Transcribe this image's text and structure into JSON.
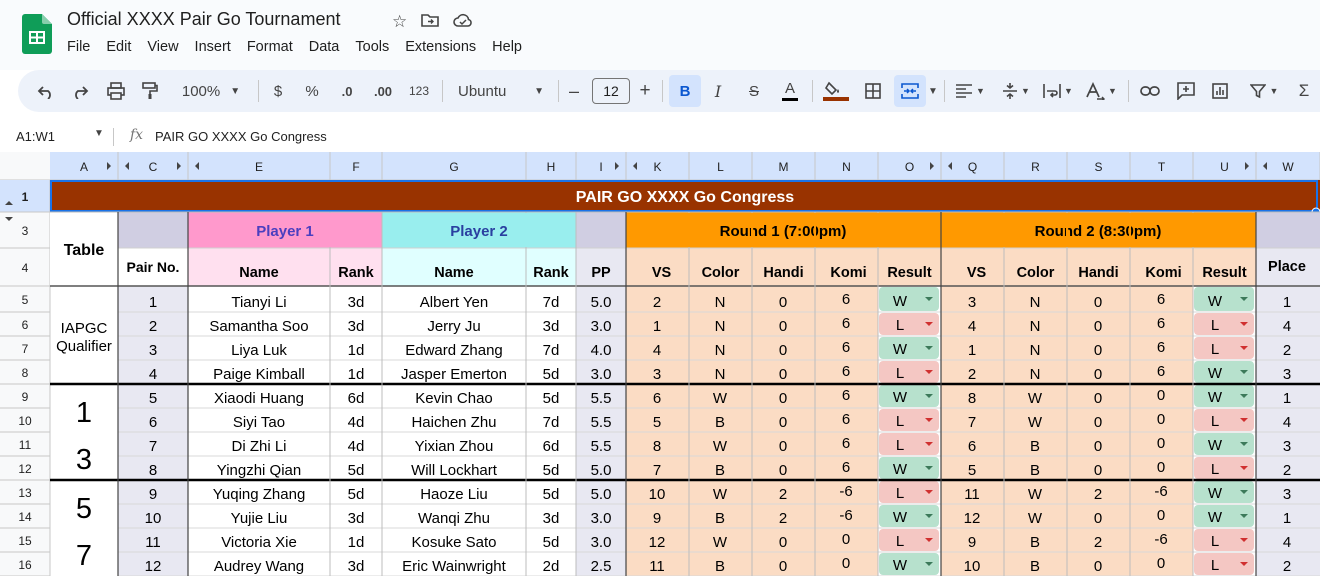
{
  "app": {
    "title": "Official XXXX Pair Go Tournament",
    "menu": [
      "File",
      "Edit",
      "View",
      "Insert",
      "Format",
      "Data",
      "Tools",
      "Extensions",
      "Help"
    ]
  },
  "toolbar": {
    "zoom": "100%",
    "currency": "$",
    "percent": "%",
    "decrease_decimals": ".0",
    "increase_decimals": ".00",
    "number_format": "123",
    "font": "Ubuntu",
    "font_size": "12",
    "bold": "B",
    "italic": "I",
    "strikethrough": "S",
    "text_color": "A"
  },
  "formula_bar": {
    "cell_ref": "A1:W1",
    "fx": "fx",
    "content": "PAIR GO XXXX Go Congress"
  },
  "columns": [
    "A",
    "C",
    "E",
    "F",
    "G",
    "H",
    "I",
    "K",
    "L",
    "M",
    "N",
    "O",
    "Q",
    "R",
    "S",
    "T",
    "U",
    "W"
  ],
  "rows": [
    "1",
    "3",
    "4",
    "5",
    "6",
    "7",
    "8",
    "9",
    "10",
    "11",
    "12",
    "13",
    "14",
    "15",
    "16"
  ],
  "sheet": {
    "banner": "PAIR GO XXXX Go Congress",
    "table_label": "Table",
    "pair_no_label": "Pair No.",
    "player1": "Player 1",
    "player2": "Player 2",
    "round1": "Round 1 (7:00pm)",
    "round2": "Round 2 (8:30pm)",
    "name_label": "Name",
    "rank_label": "Rank",
    "pp_label": "PP",
    "vs_label": "VS",
    "color_label": "Color",
    "handi_label": "Handi",
    "komi_label": "Komi",
    "result_label": "Result",
    "place_label": "Place",
    "table_groups": [
      {
        "label": "IAPGC Qualifier",
        "label_lines": [
          "IAPGC",
          "Qualifier"
        ]
      },
      {
        "label": "1 3",
        "label_lines": [
          "1",
          "3"
        ]
      },
      {
        "label": "5 7",
        "label_lines": [
          "5",
          "7"
        ]
      }
    ]
  },
  "pairs": [
    {
      "pair": "1",
      "p1": "Tianyi Li",
      "r1": "3d",
      "p2": "Albert Yen",
      "r2": "7d",
      "pp": "5.0",
      "vs1": "2",
      "c1": "N",
      "h1": "0",
      "k1": "6",
      "res1": "W",
      "vs2": "3",
      "c2": "N",
      "h2": "0",
      "k2": "6",
      "res2": "W",
      "place": "1"
    },
    {
      "pair": "2",
      "p1": "Samantha Soo",
      "r1": "3d",
      "p2": "Jerry Ju",
      "r2": "3d",
      "pp": "3.0",
      "vs1": "1",
      "c1": "N",
      "h1": "0",
      "k1": "6",
      "res1": "L",
      "vs2": "4",
      "c2": "N",
      "h2": "0",
      "k2": "6",
      "res2": "L",
      "place": "4"
    },
    {
      "pair": "3",
      "p1": "Liya Luk",
      "r1": "1d",
      "p2": "Edward Zhang",
      "r2": "7d",
      "pp": "4.0",
      "vs1": "4",
      "c1": "N",
      "h1": "0",
      "k1": "6",
      "res1": "W",
      "vs2": "1",
      "c2": "N",
      "h2": "0",
      "k2": "6",
      "res2": "L",
      "place": "2"
    },
    {
      "pair": "4",
      "p1": "Paige Kimball",
      "r1": "1d",
      "p2": "Jasper Emerton",
      "r2": "5d",
      "pp": "3.0",
      "vs1": "3",
      "c1": "N",
      "h1": "0",
      "k1": "6",
      "res1": "L",
      "vs2": "2",
      "c2": "N",
      "h2": "0",
      "k2": "6",
      "res2": "W",
      "place": "3"
    },
    {
      "pair": "5",
      "p1": "Xiaodi Huang",
      "r1": "6d",
      "p2": "Kevin Chao",
      "r2": "5d",
      "pp": "5.5",
      "vs1": "6",
      "c1": "W",
      "h1": "0",
      "k1": "6",
      "res1": "W",
      "vs2": "8",
      "c2": "W",
      "h2": "0",
      "k2": "0",
      "res2": "W",
      "place": "1"
    },
    {
      "pair": "6",
      "p1": "Siyi Tao",
      "r1": "4d",
      "p2": "Haichen Zhu",
      "r2": "7d",
      "pp": "5.5",
      "vs1": "5",
      "c1": "B",
      "h1": "0",
      "k1": "6",
      "res1": "L",
      "vs2": "7",
      "c2": "W",
      "h2": "0",
      "k2": "0",
      "res2": "L",
      "place": "4"
    },
    {
      "pair": "7",
      "p1": "Di Zhi Li",
      "r1": "4d",
      "p2": "Yixian Zhou",
      "r2": "6d",
      "pp": "5.5",
      "vs1": "8",
      "c1": "W",
      "h1": "0",
      "k1": "6",
      "res1": "L",
      "vs2": "6",
      "c2": "B",
      "h2": "0",
      "k2": "0",
      "res2": "W",
      "place": "3"
    },
    {
      "pair": "8",
      "p1": "Yingzhi Qian",
      "r1": "5d",
      "p2": "Will Lockhart",
      "r2": "5d",
      "pp": "5.0",
      "vs1": "7",
      "c1": "B",
      "h1": "0",
      "k1": "6",
      "res1": "W",
      "vs2": "5",
      "c2": "B",
      "h2": "0",
      "k2": "0",
      "res2": "L",
      "place": "2"
    },
    {
      "pair": "9",
      "p1": "Yuqing Zhang",
      "r1": "5d",
      "p2": "Haoze Liu",
      "r2": "5d",
      "pp": "5.0",
      "vs1": "10",
      "c1": "W",
      "h1": "2",
      "k1": "-6",
      "res1": "L",
      "vs2": "11",
      "c2": "W",
      "h2": "2",
      "k2": "-6",
      "res2": "W",
      "place": "3"
    },
    {
      "pair": "10",
      "p1": "Yujie Liu",
      "r1": "3d",
      "p2": "Wanqi Zhu",
      "r2": "3d",
      "pp": "3.0",
      "vs1": "9",
      "c1": "B",
      "h1": "2",
      "k1": "-6",
      "res1": "W",
      "vs2": "12",
      "c2": "W",
      "h2": "0",
      "k2": "0",
      "res2": "W",
      "place": "1"
    },
    {
      "pair": "11",
      "p1": "Victoria Xie",
      "r1": "1d",
      "p2": "Kosuke Sato",
      "r2": "5d",
      "pp": "3.0",
      "vs1": "12",
      "c1": "W",
      "h1": "0",
      "k1": "0",
      "res1": "L",
      "vs2": "9",
      "c2": "B",
      "h2": "2",
      "k2": "-6",
      "res2": "L",
      "place": "4"
    },
    {
      "pair": "12",
      "p1": "Audrey Wang",
      "r1": "3d",
      "p2": "Eric Wainwright",
      "r2": "2d",
      "pp": "2.5",
      "vs1": "11",
      "c1": "B",
      "h1": "0",
      "k1": "0",
      "res1": "W",
      "vs2": "10",
      "c2": "B",
      "h2": "0",
      "k2": "0",
      "res2": "L",
      "place": "2"
    }
  ],
  "colors": {
    "banner": "#993300",
    "player1_header": "#ff99cc",
    "player1_sub": "#ffe0ef",
    "player2_header": "#99eeee",
    "player2_sub": "#e0ffff",
    "round_header": "#ff9900",
    "round_body": "#fbdcc4",
    "lavender": "#d0cee2",
    "lavender_light": "#e8e8f2",
    "win": "#b7e1cd",
    "loss": "#f4c7c3",
    "selected_header": "#d3e3fd"
  },
  "icons": [
    "sheets-logo",
    "star-icon",
    "move-folder-icon",
    "cloud-status-icon",
    "undo-icon",
    "redo-icon",
    "print-icon",
    "paint-format-icon",
    "borders-icon",
    "merge-cells-icon",
    "align-icon",
    "valign-icon",
    "text-rotation-icon",
    "text-color-icon",
    "link-icon",
    "comment-icon",
    "chart-icon",
    "filter-icon",
    "functions-icon"
  ]
}
